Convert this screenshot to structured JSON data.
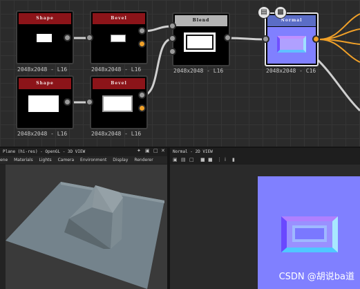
{
  "graph": {
    "nodes": [
      {
        "title": "Shape",
        "resolution": "2048x2048 - L16"
      },
      {
        "title": "Bevel",
        "resolution": "2048x2048 - L16"
      },
      {
        "title": "Shape",
        "resolution": "2048x2048 - L16"
      },
      {
        "title": "Bevel",
        "resolution": "2048x2048 - L16"
      },
      {
        "title": "Blend",
        "resolution": "2048x2048 - L16"
      },
      {
        "title": "Normal",
        "resolution": "2048x2048 - C16"
      }
    ],
    "icons": [
      "document-icon",
      "pattern-icon"
    ],
    "colors": {
      "wire": "#cfcfcf",
      "output_wire": "#f0a028",
      "red_header": "#8c1419",
      "normal_blue": "#8080ff"
    }
  },
  "view3d": {
    "title": "Plane (hi-res) - OpenGL - 3D VIEW",
    "menu": [
      "ene",
      "Materials",
      "Lights",
      "Camera",
      "Environment",
      "Display",
      "Renderer"
    ]
  },
  "view2d": {
    "title": "Normal - 2D VIEW"
  },
  "watermark": "CSDN @胡说ba道"
}
